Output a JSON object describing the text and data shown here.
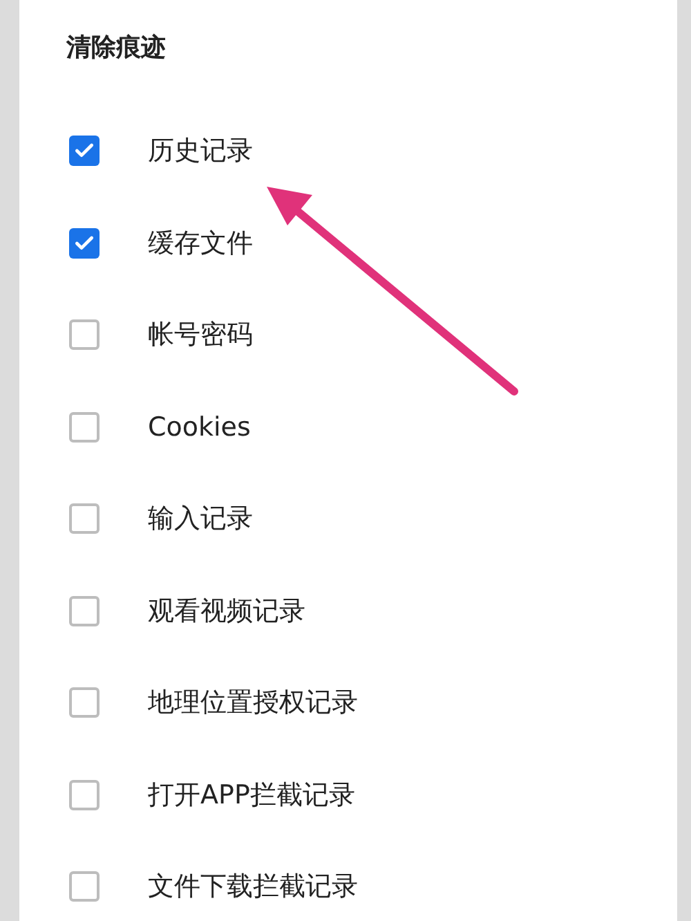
{
  "title": "清除痕迹",
  "items": [
    {
      "label": "历史记录",
      "checked": true
    },
    {
      "label": "缓存文件",
      "checked": true
    },
    {
      "label": "帐号密码",
      "checked": false
    },
    {
      "label": "Cookies",
      "checked": false
    },
    {
      "label": "输入记录",
      "checked": false
    },
    {
      "label": "观看视频记录",
      "checked": false
    },
    {
      "label": "地理位置授权记录",
      "checked": false
    },
    {
      "label": "打开APP拦截记录",
      "checked": false
    },
    {
      "label": "文件下载拦截记录",
      "checked": false
    }
  ]
}
